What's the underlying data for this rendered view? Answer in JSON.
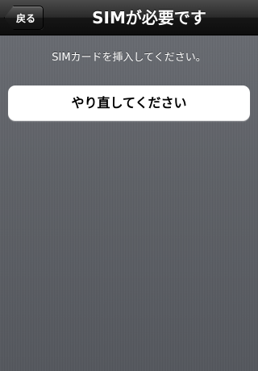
{
  "nav": {
    "back_label": "戻る",
    "title": "SIMが必要です"
  },
  "main": {
    "message": "SIMカードを挿入してください。",
    "retry_label": "やり直してください"
  },
  "colors": {
    "background": "#5e6167",
    "navbar": "#1a1a1a",
    "button_bg": "#ffffff",
    "text_light": "#ffffff",
    "text_dark": "#000000"
  }
}
